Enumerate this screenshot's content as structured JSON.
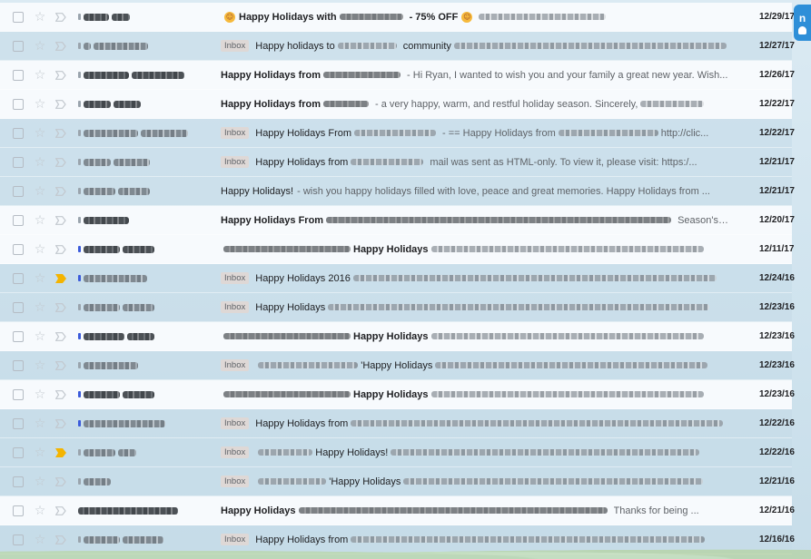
{
  "side_widget": {
    "letter": "n"
  },
  "emails": [
    {
      "state": "unread",
      "important": false,
      "sender_widths": [
        28,
        20
      ],
      "dot": "grey",
      "label": "",
      "emoji_lead": true,
      "subject": "Happy Holidays with",
      "subject_tail": "- 75% OFF",
      "emoji_tail": true,
      "snippet": "",
      "blur_before": 0,
      "blur_mid": 70,
      "blur_after": 140,
      "date": "12/29/17"
    },
    {
      "state": "read",
      "important": false,
      "sender_widths": [
        8,
        60
      ],
      "dot": "grey",
      "label": "Inbox",
      "emoji_lead": false,
      "subject": "Happy holidays to",
      "subject_tail": "community",
      "emoji_tail": false,
      "snippet": "",
      "blur_before": 0,
      "blur_mid": 65,
      "blur_after": 300,
      "date": "12/27/17"
    },
    {
      "state": "unread",
      "important": false,
      "sender_widths": [
        50,
        58
      ],
      "dot": "grey",
      "label": "",
      "emoji_lead": false,
      "subject": "Happy Holidays from",
      "subject_tail": "",
      "emoji_tail": false,
      "snippet": "- Hi Ryan, I wanted to wish you and your family a great new year. Wish...",
      "blur_before": 0,
      "blur_mid": 85,
      "blur_after": 0,
      "date": "12/26/17"
    },
    {
      "state": "unread",
      "important": false,
      "sender_widths": [
        30,
        30
      ],
      "dot": "grey",
      "label": "",
      "emoji_lead": false,
      "subject": "Happy Holidays from",
      "subject_tail": "",
      "emoji_tail": false,
      "snippet": "- a very happy, warm, and restful holiday season. Sincerely,",
      "blur_before": 0,
      "blur_mid": 50,
      "blur_after": 70,
      "date": "12/22/17"
    },
    {
      "state": "read",
      "important": false,
      "sender_widths": [
        60,
        52
      ],
      "dot": "grey",
      "label": "Inbox",
      "emoji_lead": false,
      "subject": "Happy Holidays From",
      "subject_tail": "",
      "emoji_tail": false,
      "snippet": "- == Happy Holidays from",
      "blur_before": 0,
      "blur_mid": 90,
      "blur_after": 110,
      "date": "12/22/17",
      "snippet_tail": "http://clic..."
    },
    {
      "state": "read",
      "important": false,
      "sender_widths": [
        30,
        40
      ],
      "dot": "grey",
      "label": "Inbox",
      "emoji_lead": false,
      "subject": "Happy Holidays from",
      "subject_tail": "",
      "emoji_tail": false,
      "snippet": "mail was sent as HTML-only. To view it, please visit: https:/...",
      "blur_before": 0,
      "blur_mid": 80,
      "blur_after": 0,
      "date": "12/21/17"
    },
    {
      "state": "read",
      "important": false,
      "sender_widths": [
        35,
        35
      ],
      "dot": "grey",
      "label": "",
      "emoji_lead": false,
      "subject": "Happy Holidays!",
      "subject_tail": "",
      "emoji_tail": false,
      "snippet": "- wish you happy holidays filled with love, peace and great memories. Happy Holidays from ...",
      "blur_before": 0,
      "blur_mid": 0,
      "blur_after": 0,
      "date": "12/21/17"
    },
    {
      "state": "unread",
      "important": false,
      "sender_widths": [
        50
      ],
      "dot": "grey",
      "label": "",
      "emoji_lead": false,
      "subject": "Happy Holidays From",
      "subject_tail": "",
      "emoji_tail": false,
      "snippet": "Season's ...",
      "blur_before": 0,
      "blur_mid": 380,
      "blur_after": 0,
      "date": "12/20/17"
    },
    {
      "state": "unread",
      "important": false,
      "sender_widths": [
        40,
        35
      ],
      "dot": "blue",
      "label": "",
      "emoji_lead": false,
      "subject": "Happy Holidays",
      "subject_tail": "",
      "emoji_tail": false,
      "snippet": "",
      "blur_before": 140,
      "blur_mid": 0,
      "blur_after": 300,
      "date": "12/11/17"
    },
    {
      "state": "read",
      "important": true,
      "sender_widths": [
        70
      ],
      "dot": "blue",
      "label": "Inbox",
      "emoji_lead": false,
      "subject": "Happy Holidays 2016",
      "subject_tail": "",
      "emoji_tail": false,
      "snippet": "",
      "blur_before": 0,
      "blur_mid": 0,
      "blur_after": 400,
      "date": "12/24/16"
    },
    {
      "state": "read",
      "important": false,
      "sender_widths": [
        40,
        35
      ],
      "dot": "grey",
      "label": "Inbox",
      "emoji_lead": false,
      "subject": "Happy Holidays",
      "subject_tail": "",
      "emoji_tail": false,
      "snippet": "",
      "blur_before": 0,
      "blur_mid": 0,
      "blur_after": 420,
      "date": "12/23/16"
    },
    {
      "state": "unread",
      "important": false,
      "sender_widths": [
        45,
        30
      ],
      "dot": "blue",
      "label": "",
      "emoji_lead": false,
      "subject": "Happy Holidays",
      "subject_tail": "",
      "emoji_tail": false,
      "snippet": "",
      "blur_before": 140,
      "blur_mid": 0,
      "blur_after": 300,
      "date": "12/23/16"
    },
    {
      "state": "read",
      "important": false,
      "sender_widths": [
        60
      ],
      "dot": "grey",
      "label": "Inbox",
      "emoji_lead": false,
      "subject": "'Happy Holidays",
      "subject_tail": "",
      "emoji_tail": false,
      "snippet": "",
      "blur_before": 110,
      "blur_mid": 0,
      "blur_after": 300,
      "date": "12/23/16"
    },
    {
      "state": "unread",
      "important": false,
      "sender_widths": [
        40,
        35
      ],
      "dot": "blue",
      "label": "",
      "emoji_lead": false,
      "subject": "Happy Holidays",
      "subject_tail": "",
      "emoji_tail": false,
      "snippet": "",
      "blur_before": 140,
      "blur_mid": 0,
      "blur_after": 300,
      "date": "12/23/16"
    },
    {
      "state": "read",
      "important": false,
      "sender_widths": [
        90
      ],
      "dot": "blue",
      "label": "Inbox",
      "emoji_lead": false,
      "subject": "Happy Holidays from",
      "subject_tail": "",
      "emoji_tail": false,
      "snippet": "",
      "blur_before": 0,
      "blur_mid": 0,
      "blur_after": 410,
      "date": "12/22/16"
    },
    {
      "state": "read",
      "important": true,
      "sender_widths": [
        35,
        20
      ],
      "dot": "grey",
      "label": "Inbox",
      "emoji_lead": false,
      "subject": "Happy Holidays!",
      "subject_tail": "",
      "emoji_tail": false,
      "snippet": "",
      "blur_before": 60,
      "blur_mid": 0,
      "blur_after": 340,
      "date": "12/22/16"
    },
    {
      "state": "read",
      "important": false,
      "sender_widths": [
        30
      ],
      "dot": "grey",
      "label": "Inbox",
      "emoji_lead": false,
      "subject": "'Happy Holidays",
      "subject_tail": "",
      "emoji_tail": false,
      "snippet": "",
      "blur_before": 75,
      "blur_mid": 0,
      "blur_after": 330,
      "date": "12/21/16"
    },
    {
      "state": "unread",
      "important": false,
      "sender_widths": [
        110
      ],
      "dot": "none",
      "label": "",
      "emoji_lead": false,
      "subject": "Happy Holidays",
      "subject_tail": "",
      "emoji_tail": false,
      "snippet": "Thanks for being ...",
      "blur_before": 0,
      "blur_mid": 340,
      "blur_after": 0,
      "date": "12/21/16"
    },
    {
      "state": "read",
      "important": false,
      "sender_widths": [
        40,
        45
      ],
      "dot": "grey",
      "label": "Inbox",
      "emoji_lead": false,
      "subject": "Happy Holidays from",
      "subject_tail": "",
      "emoji_tail": false,
      "snippet": "",
      "blur_before": 0,
      "blur_mid": 0,
      "blur_after": 390,
      "date": "12/16/16"
    }
  ]
}
